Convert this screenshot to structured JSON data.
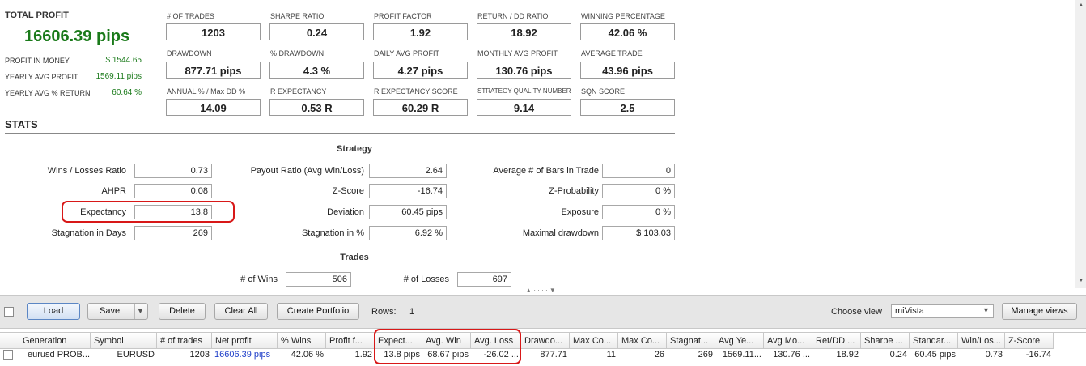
{
  "summary": {
    "total_profit_label": "TOTAL PROFIT",
    "total_profit_value": "16606.39 pips",
    "rows": [
      {
        "label": "PROFIT IN MONEY",
        "value": "$ 1544.65"
      },
      {
        "label": "YEARLY AVG PROFIT",
        "value": "1569.11 pips"
      },
      {
        "label": "YEARLY AVG % RETURN",
        "value": "60.64 %"
      }
    ]
  },
  "metrics": [
    {
      "label": "# OF TRADES",
      "value": "1203"
    },
    {
      "label": "SHARPE RATIO",
      "value": "0.24"
    },
    {
      "label": "PROFIT FACTOR",
      "value": "1.92"
    },
    {
      "label": "RETURN / DD RATIO",
      "value": "18.92"
    },
    {
      "label": "WINNING PERCENTAGE",
      "value": "42.06 %"
    },
    {
      "label": "DRAWDOWN",
      "value": "877.71 pips"
    },
    {
      "label": "% DRAWDOWN",
      "value": "4.3 %"
    },
    {
      "label": "DAILY AVG PROFIT",
      "value": "4.27 pips"
    },
    {
      "label": "MONTHLY AVG PROFIT",
      "value": "130.76 pips"
    },
    {
      "label": "AVERAGE TRADE",
      "value": "43.96 pips"
    },
    {
      "label": "ANNUAL % / Max DD %",
      "value": "14.09"
    },
    {
      "label": "R EXPECTANCY",
      "value": "0.53 R"
    },
    {
      "label": "R EXPECTANCY SCORE",
      "value": "60.29 R"
    },
    {
      "label": "STRATEGY QUALITY NUMBER",
      "value": "9.14"
    },
    {
      "label": "SQN SCORE",
      "value": "2.5"
    }
  ],
  "stats": {
    "title": "STATS",
    "strategy_title": "Strategy",
    "col1": [
      {
        "label": "Wins / Losses Ratio",
        "value": "0.73"
      },
      {
        "label": "AHPR",
        "value": "0.08"
      },
      {
        "label": "Expectancy",
        "value": "13.8"
      },
      {
        "label": "Stagnation in Days",
        "value": "269"
      }
    ],
    "col2": [
      {
        "label": "Payout Ratio (Avg Win/Loss)",
        "value": "2.64"
      },
      {
        "label": "Z-Score",
        "value": "-16.74"
      },
      {
        "label": "Deviation",
        "value": "60.45 pips"
      },
      {
        "label": "Stagnation in %",
        "value": "6.92 %"
      }
    ],
    "col3": [
      {
        "label": "Average # of Bars in Trade",
        "value": "0"
      },
      {
        "label": "Z-Probability",
        "value": "0 %"
      },
      {
        "label": "Exposure",
        "value": "0 %"
      },
      {
        "label": "Maximal drawdown",
        "value": "$ 103.03"
      }
    ],
    "trades_title": "Trades",
    "wins_label": "# of Wins",
    "wins_value": "506",
    "losses_label": "# of Losses",
    "losses_value": "697"
  },
  "toolbar": {
    "load": "Load",
    "save": "Save",
    "delete": "Delete",
    "clear_all": "Clear All",
    "create_portfolio": "Create Portfolio",
    "rows_label": "Rows:",
    "rows_value": "1",
    "choose_view_label": "Choose view",
    "view_value": "miVista",
    "manage_views": "Manage views"
  },
  "grid": {
    "columns": [
      "Generation",
      "Symbol",
      "# of trades",
      "Net profit",
      "% Wins",
      "Profit f...",
      "Expect...",
      "Avg. Win",
      "Avg. Loss",
      "Drawdo...",
      "Max Co...",
      "Max Co...",
      "Stagnat...",
      "Avg Ye...",
      "Avg Mo...",
      "Ret/DD ...",
      "Sharpe ...",
      "Standar...",
      "Win/Los...",
      "Z-Score"
    ],
    "row": [
      "eurusd PROB...",
      "EURUSD",
      "1203",
      "16606.39 pips",
      "42.06 %",
      "1.92",
      "13.8 pips",
      "68.67 pips",
      "-26.02 ...",
      "877.71",
      "11",
      "26",
      "269",
      "1569.11...",
      "130.76 ...",
      "18.92",
      "0.24",
      "60.45 pips",
      "0.73",
      "-16.74"
    ]
  },
  "colors": {
    "profit_green": "#1a7a1a",
    "link_blue": "#1e3ec8",
    "highlight_red": "#d81818"
  }
}
